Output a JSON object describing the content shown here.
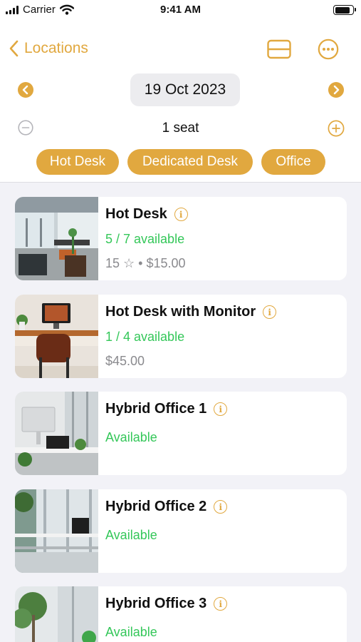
{
  "status_bar": {
    "carrier": "Carrier",
    "time": "9:41 AM",
    "battery_level": 0.9
  },
  "nav": {
    "back_label": "Locations",
    "back_icon": "chevron-left-icon",
    "card_icon": "card-icon",
    "more_icon": "ellipsis-circle-icon"
  },
  "date_selector": {
    "date": "19 Oct 2023",
    "prev_icon": "chevron-left-circle-icon",
    "next_icon": "chevron-right-circle-icon"
  },
  "seats": {
    "label": "1 seat",
    "decrement_icon": "minus-circle-icon",
    "increment_icon": "plus-circle-icon"
  },
  "filters": [
    "Hot Desk",
    "Dedicated Desk",
    "Office"
  ],
  "accent_color": "#e1a83f",
  "available_color": "#34c759",
  "spaces": [
    {
      "title": "Hot Desk",
      "availability": "5 / 7 available",
      "meta": "15 ☆ • $15.00"
    },
    {
      "title": "Hot Desk with Monitor",
      "availability": "1 / 4 available",
      "meta": "$45.00"
    },
    {
      "title": "Hybrid Office 1",
      "availability": "Available",
      "meta": ""
    },
    {
      "title": "Hybrid Office 2",
      "availability": "Available",
      "meta": ""
    },
    {
      "title": "Hybrid Office 3",
      "availability": "Available",
      "meta": ""
    }
  ]
}
